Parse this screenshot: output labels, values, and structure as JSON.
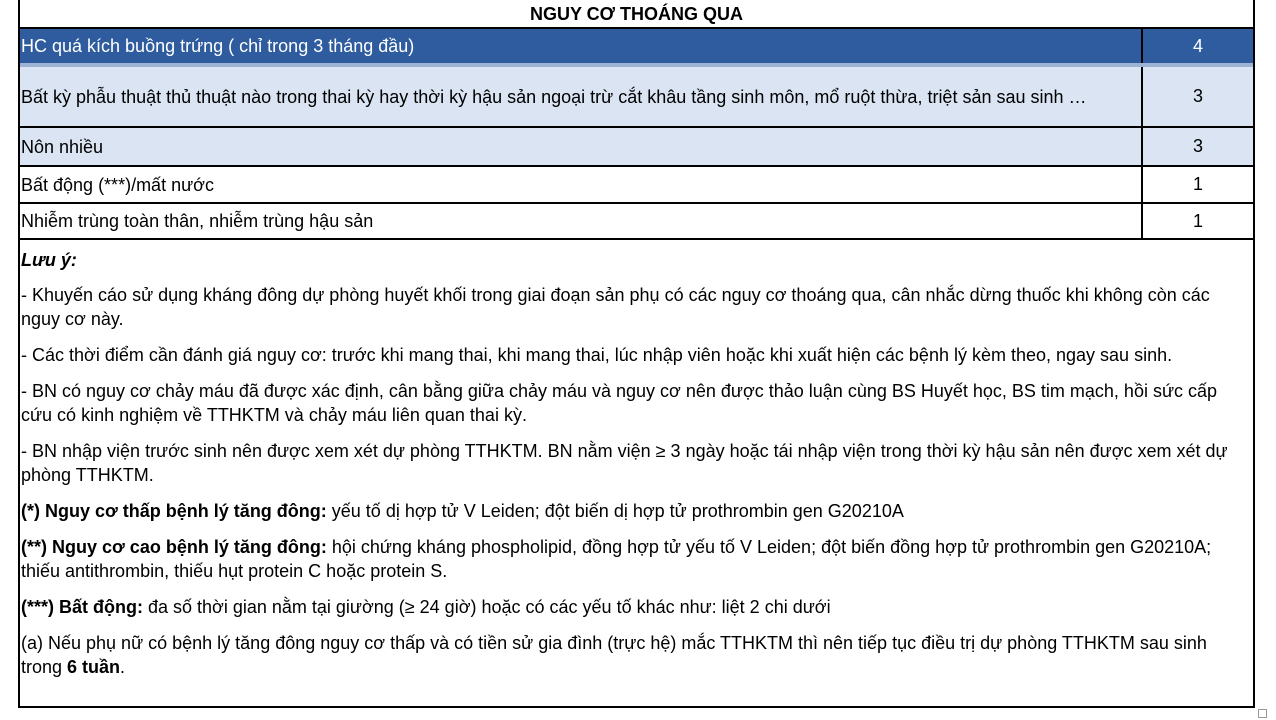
{
  "table": {
    "title": "NGUY CƠ THOÁNG QUA",
    "rows": [
      {
        "label": "HC quá kích buồng trứng ( chỉ trong 3 tháng đầu)",
        "score": "4"
      },
      {
        "label": "Bất kỳ phẫu thuật thủ thuật nào trong thai kỳ hay thời kỳ hậu sản ngoại trừ cắt khâu tầng sinh môn, mổ ruột thừa, triệt sản sau sinh …",
        "score": "3"
      },
      {
        "label": "Nôn nhiều",
        "score": "3"
      },
      {
        "label": "Bất động (***)/mất nước",
        "score": "1"
      },
      {
        "label": "Nhiễm trùng toàn thân, nhiễm trùng hậu sản",
        "score": "1"
      }
    ]
  },
  "notes": {
    "heading": "Lưu ý:",
    "items": [
      "- Khuyến cáo sử dụng kháng đông dự phòng huyết khối trong giai đoạn sản phụ có các nguy cơ thoáng qua, cân nhắc dừng thuốc khi không còn các nguy cơ này.",
      "- Các thời điểm cần đánh giá nguy cơ: trước khi mang thai, khi mang thai, lúc nhập viên hoặc khi xuất hiện các bệnh lý kèm theo, ngay sau sinh.",
      "- BN có nguy cơ chảy máu đã được xác định, cân bằng giữa chảy máu và nguy cơ nên được thảo luận cùng BS Huyết học, BS tim mạch, hồi sức cấp cứu có kinh nghiệm về TTHKTM và chảy máu liên quan thai kỳ.",
      "- BN nhập viện trước sinh nên được xem xét dự phòng TTHKTM. BN nằm viện ≥ 3 ngày hoặc tái nhập viện trong thời kỳ hậu sản nên được xem xét dự phòng TTHKTM."
    ],
    "definitions": [
      {
        "term": "(*) Nguy cơ thấp bệnh lý tăng đông:",
        "text": " yếu tố dị hợp tử V Leiden; đột biến dị hợp tử prothrombin gen G20210A"
      },
      {
        "term": "(**) Nguy cơ cao bệnh lý tăng đông:",
        "text": " hội chứng kháng phospholipid, đồng hợp tử yếu tố V Leiden; đột biến đồng hợp tử prothrombin gen G20210A; thiếu antithrombin, thiếu hụt protein C hoặc protein S."
      },
      {
        "term": "(***) Bất động:",
        "text": " đa số thời gian nằm tại giường (≥ 24 giờ) hoặc có các yếu tố khác như: liệt 2 chi dưới"
      }
    ],
    "final": {
      "text": "(a) Nếu phụ nữ có bệnh lý tăng đông nguy cơ thấp và có tiền sử gia đình (trực hệ) mắc TTHKTM thì nên tiếp tục điều trị dự phòng TTHKTM sau sinh trong ",
      "bold": "6 tuần",
      "end": "."
    }
  },
  "colors": {
    "highlight_row": "#2e5c9e",
    "light_row": "#dae4f2",
    "highlight_separator": "#9cb3d4"
  }
}
